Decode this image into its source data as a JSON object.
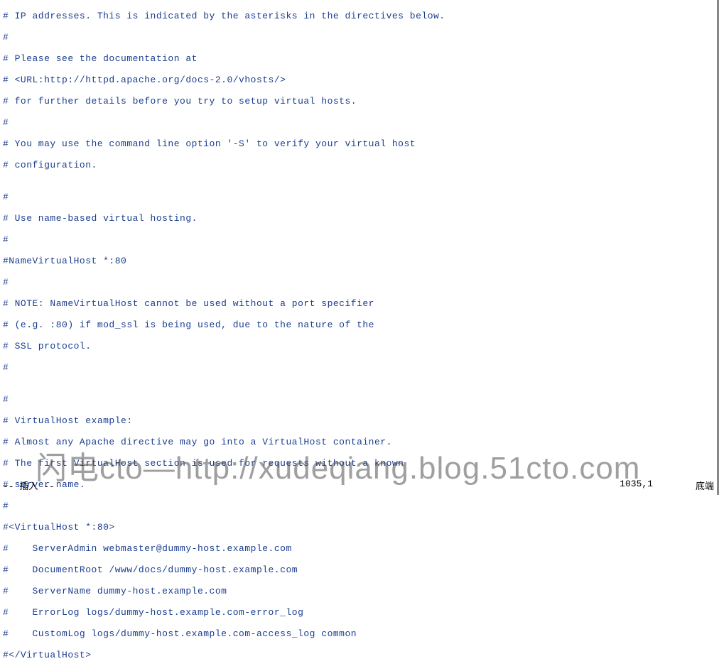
{
  "editor": {
    "lines": [
      "# IP addresses. This is indicated by the asterisks in the directives below.",
      "#",
      "# Please see the documentation at",
      "# <URL:http://httpd.apache.org/docs-2.0/vhosts/>",
      "# for further details before you try to setup virtual hosts.",
      "#",
      "# You may use the command line option '-S' to verify your virtual host",
      "# configuration.",
      "",
      "#",
      "# Use name-based virtual hosting.",
      "#",
      "#NameVirtualHost *:80",
      "#",
      "# NOTE: NameVirtualHost cannot be used without a port specifier",
      "# (e.g. :80) if mod_ssl is being used, due to the nature of the",
      "# SSL protocol.",
      "#",
      "",
      "#",
      "# VirtualHost example:",
      "# Almost any Apache directive may go into a VirtualHost container.",
      "# The first VirtualHost section is used for requests without a known",
      "# server name.",
      "#",
      "#<VirtualHost *:80>",
      "#    ServerAdmin webmaster@dummy-host.example.com",
      "#    DocumentRoot /www/docs/dummy-host.example.com",
      "#    ServerName dummy-host.example.com",
      "#    ErrorLog logs/dummy-host.example.com-error_log",
      "#    CustomLog logs/dummy-host.example.com-access_log common",
      "#</VirtualHost>"
    ]
  },
  "status": {
    "mode": "-- 插入 --",
    "position": "1035,1",
    "scroll": "底端"
  },
  "watermark": {
    "text": "闪电cto—http://xudeqiang.blog.51cto.com"
  }
}
